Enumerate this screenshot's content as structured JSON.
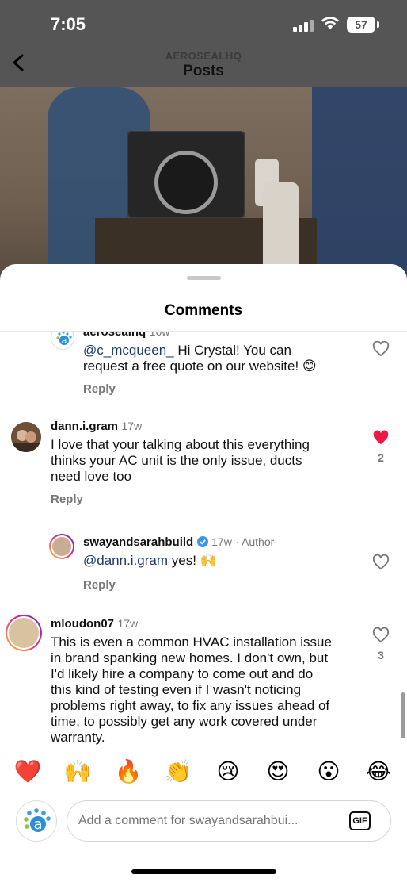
{
  "status_bar": {
    "time": "7:05",
    "battery": "57"
  },
  "header": {
    "subtitle": "AEROSEALHQ",
    "title": "Posts"
  },
  "sheet": {
    "title": "Comments"
  },
  "comments": [
    {
      "username": "aerosealhq",
      "time": "16w",
      "mention": "@c_mcqueen_",
      "text_line1": " Hi Crystal! You can",
      "text_line2": "request a free quote on our website! 😊",
      "reply_label": "Reply",
      "liked": false
    },
    {
      "username": "dann.i.gram",
      "time": "17w",
      "lines": [
        "I love that your talking about this everything",
        "thinks your AC unit is the only issue, ducts",
        "need love too"
      ],
      "reply_label": "Reply",
      "liked": true,
      "like_count": "2"
    },
    {
      "username": "swayandsarahbuild",
      "time": "17w",
      "author_tag": "· Author",
      "mention": "@dann.i.gram",
      "text": " yes! 🙌",
      "reply_label": "Reply",
      "liked": false
    },
    {
      "username": "mloudon07",
      "time": "17w",
      "lines": [
        "This is even a common HVAC installation issue",
        "in brand spanking new homes. I don't own, but",
        "I'd likely hire a company to come out and do",
        "this kind of testing even if I wasn't noticing",
        "problems right away, to fix any issues ahead of",
        "time, to possibly get any work covered under",
        "warranty."
      ],
      "liked": false,
      "like_count": "3"
    }
  ],
  "emoji_bar": [
    "❤️",
    "🙌",
    "🔥",
    "👏",
    "😢",
    "😍",
    "😮",
    "😂"
  ],
  "composer": {
    "placeholder": "Add a comment for swayandsarahbui...",
    "gif_label": "GIF"
  },
  "colors": {
    "accent_link": "#1b3a6b",
    "like_red": "#ed1944",
    "verified_blue": "#3897f0"
  }
}
